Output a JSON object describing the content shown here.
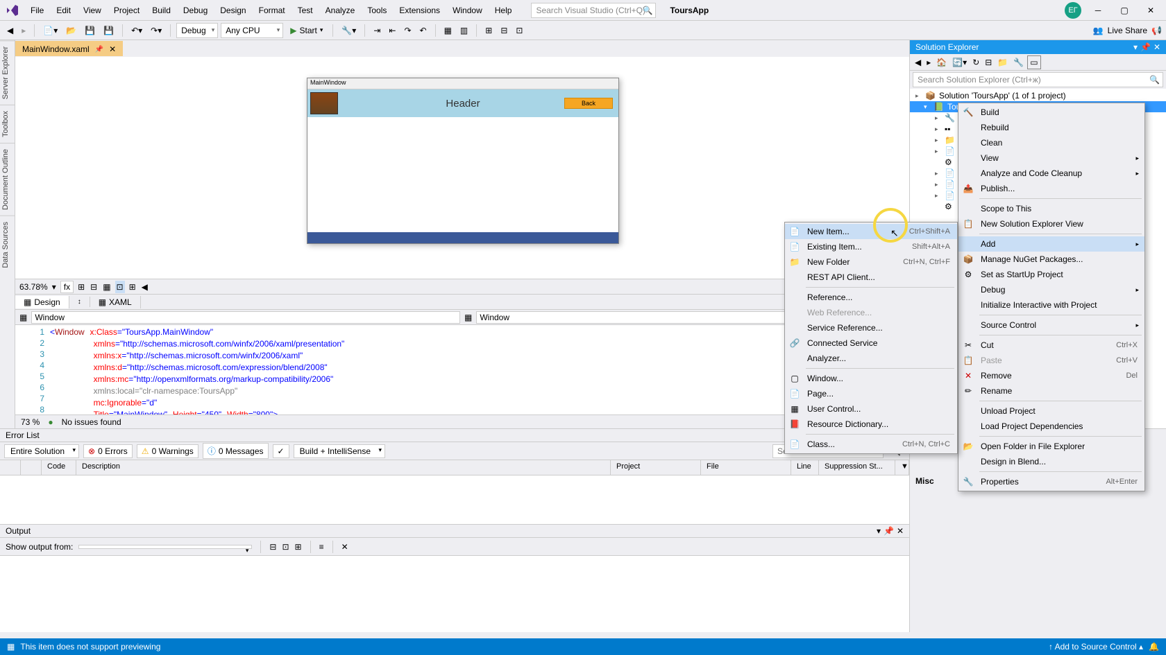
{
  "titlebar": {
    "app_name": "ToursApp",
    "user_initials": "ЕГ",
    "menu": [
      "File",
      "Edit",
      "View",
      "Project",
      "Build",
      "Debug",
      "Design",
      "Format",
      "Test",
      "Analyze",
      "Tools",
      "Extensions",
      "Window",
      "Help"
    ],
    "search_placeholder": "Search Visual Studio (Ctrl+Q)"
  },
  "toolbar": {
    "config": "Debug",
    "platform": "Any CPU",
    "start": "Start",
    "live_share": "Live Share"
  },
  "doc_tab": "MainWindow.xaml",
  "left_rail": [
    "Server Explorer",
    "Toolbox",
    "Document Outline",
    "Data Sources"
  ],
  "designer": {
    "window_title": "MainWindow",
    "header_text": "Header",
    "back_button": "Back",
    "zoom": "63.78%",
    "tab_design": "Design",
    "tab_xaml": "XAML",
    "combo_window": "Window"
  },
  "code": {
    "lines": [
      "1",
      "2",
      "3",
      "4",
      "5",
      "6",
      "7",
      "8"
    ],
    "l1_a": "Window",
    "l1_b": "x:Class",
    "l1_c": "\"ToursApp.MainWindow\"",
    "l2_a": "xmlns",
    "l2_b": "\"http://schemas.microsoft.com/winfx/2006/xaml/presentation\"",
    "l3_a": "xmlns:x",
    "l3_b": "\"http://schemas.microsoft.com/winfx/2006/xaml\"",
    "l4_a": "xmlns:d",
    "l4_b": "\"http://schemas.microsoft.com/expression/blend/2008\"",
    "l5_a": "xmlns:mc",
    "l5_b": "\"http://openxmlformats.org/markup-compatibility/2006\"",
    "l6_a": "xmlns:local",
    "l6_b": "\"clr-namespace:ToursApp\"",
    "l7_a": "mc:Ignorable",
    "l7_b": "\"d\"",
    "l8_a": "Title",
    "l8_b": "\"MainWindow\"",
    "l8_c": "Height",
    "l8_d": "\"450\"",
    "l8_e": "Width",
    "l8_f": "\"800\""
  },
  "code_status": {
    "pct": "73 %",
    "issues": "No issues found"
  },
  "solution": {
    "title": "Solution Explorer",
    "search_placeholder": "Search Solution Explorer (Ctrl+ж)",
    "root": "Solution 'ToursApp' (1 of 1 project)",
    "project": "Tour..."
  },
  "ctx_main": {
    "build": "Build",
    "rebuild": "Rebuild",
    "clean": "Clean",
    "view": "View",
    "analyze": "Analyze and Code Cleanup",
    "publish": "Publish...",
    "scope": "Scope to This",
    "newview": "New Solution Explorer View",
    "add": "Add",
    "nuget": "Manage NuGet Packages...",
    "startup": "Set as StartUp Project",
    "debug": "Debug",
    "interactive": "Initialize Interactive with Project",
    "source": "Source Control",
    "cut": "Cut",
    "cut_sc": "Ctrl+X",
    "paste": "Paste",
    "paste_sc": "Ctrl+V",
    "remove": "Remove",
    "remove_sc": "Del",
    "rename": "Rename",
    "unload": "Unload Project",
    "loaddep": "Load Project Dependencies",
    "openfolder": "Open Folder in File Explorer",
    "blend": "Design in Blend...",
    "props": "Properties",
    "props_sc": "Alt+Enter"
  },
  "ctx_add": {
    "newitem": "New Item...",
    "newitem_sc": "Ctrl+Shift+A",
    "existing": "Existing Item...",
    "existing_sc": "Shift+Alt+A",
    "newfolder": "New Folder",
    "newfolder_sc": "Ctrl+N, Ctrl+F",
    "rest": "REST API Client...",
    "ref": "Reference...",
    "webref": "Web Reference...",
    "svcref": "Service Reference...",
    "connsvc": "Connected Service",
    "analyzer": "Analyzer...",
    "window": "Window...",
    "page": "Page...",
    "usercontrol": "User Control...",
    "resdict": "Resource Dictionary...",
    "class": "Class...",
    "class_sc": "Ctrl+N, Ctrl+C"
  },
  "error_list": {
    "title": "Error List",
    "scope": "Entire Solution",
    "errors": "0 Errors",
    "warnings": "0 Warnings",
    "messages": "0 Messages",
    "filter": "Build + IntelliSense",
    "search": "Search Error List",
    "cols": {
      "code": "Code",
      "desc": "Description",
      "project": "Project",
      "file": "File",
      "line": "Line",
      "supp": "Suppression St..."
    }
  },
  "output": {
    "title": "Output",
    "label": "Show output from:"
  },
  "props": {
    "misc": "Misc"
  },
  "statusbar": {
    "msg": "This item does not support previewing",
    "source_control": "Add to Source Control"
  }
}
